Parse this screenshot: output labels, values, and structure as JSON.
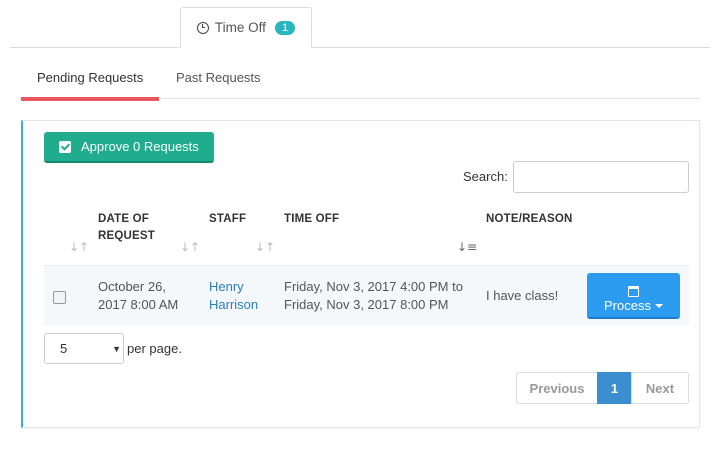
{
  "top_tab": {
    "label": "Time Off",
    "badge": "1",
    "icon": "clock-icon"
  },
  "subtabs": [
    {
      "label": "Pending Requests",
      "active": true
    },
    {
      "label": "Past Requests",
      "active": false
    }
  ],
  "toolbar": {
    "approve_label": "Approve 0 Requests",
    "approve_icon": "check-square-icon"
  },
  "search": {
    "label": "Search:",
    "value": ""
  },
  "table": {
    "columns": [
      "DATE OF REQUEST",
      "STAFF",
      "TIME OFF",
      "NOTE/REASON"
    ],
    "rows": [
      {
        "date_line1": "October 26,",
        "date_line2": "2017 8:00 AM",
        "staff_first": "Henry",
        "staff_last": "Harrison",
        "timeoff_line1": "Friday, Nov 3, 2017 4:00 PM to",
        "timeoff_line2": "Friday, Nov 3, 2017 8:00 PM",
        "note": "I have class!",
        "action_label": "Process"
      }
    ]
  },
  "pagination": {
    "per_page_value": "5",
    "per_page_label": "per page.",
    "prev_label": "Previous",
    "current_page": "1",
    "next_label": "Next"
  },
  "colors": {
    "accent_tab": "#e8585c",
    "approve": "#1fad8e",
    "process": "#2c9cf0",
    "badge": "#2ab5bf",
    "page_active": "#3b8ed0"
  }
}
